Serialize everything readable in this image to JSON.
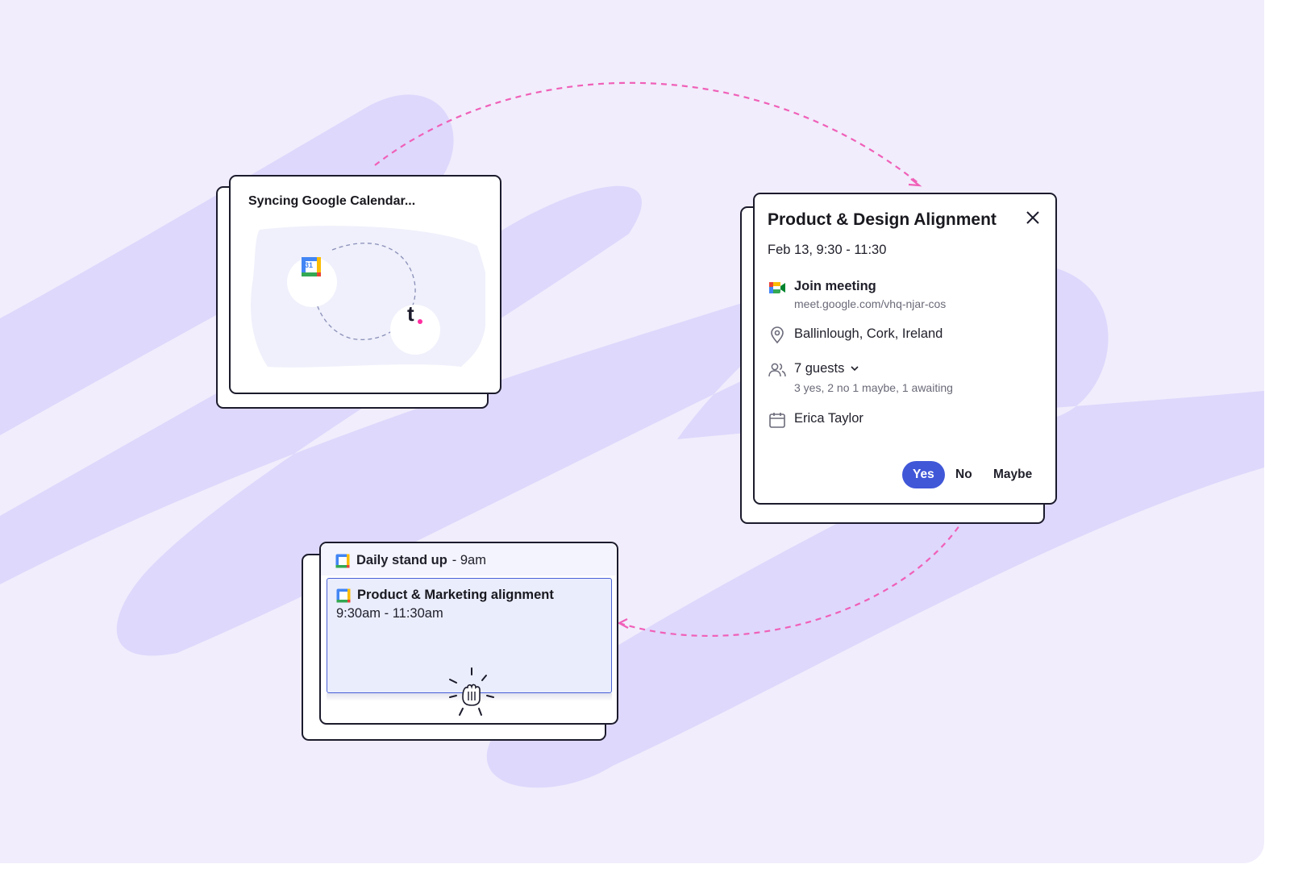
{
  "sync_card": {
    "title": "Syncing Google Calendar...",
    "gcal_day": "31",
    "brand_letter": "t"
  },
  "event_popup": {
    "title": "Product & Design Alignment",
    "date": "Feb 13, 9:30 - 11:30",
    "join_label": "Join meeting",
    "meet_url": "meet.google.com/vhq-njar-cos",
    "location": "Ballinlough, Cork, Ireland",
    "guests_label": "7 guests",
    "guests_summary": "3 yes, 2 no 1 maybe, 1 awaiting",
    "organizer": "Erica Taylor",
    "rsvp": {
      "yes": "Yes",
      "no": "No",
      "maybe": "Maybe"
    }
  },
  "calendar_view": {
    "standup_title": "Daily stand up",
    "standup_time": "- 9am",
    "event_title": "Product & Marketing alignment",
    "event_time": "9:30am - 11:30am",
    "gcal_day": "31"
  },
  "colors": {
    "background": "#f1edfc",
    "blob": "#ded8fc",
    "accent_blue": "#4057d8",
    "arrow_pink": "#f060b8",
    "brand_dot": "#ff2da0"
  }
}
